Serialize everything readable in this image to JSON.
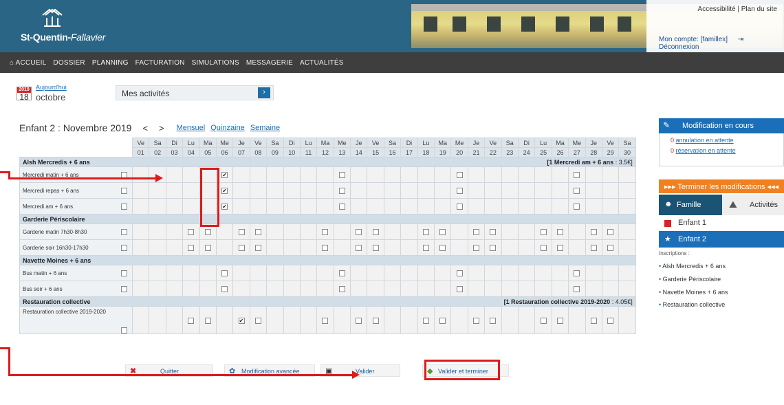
{
  "header": {
    "logo_line1": "St-Quentin-",
    "logo_line2": "Fallavier",
    "link_accessibility": "Accessibilité",
    "link_separator": "|",
    "link_sitemap": "Plan du site",
    "account": "Mon compte: [famillex]",
    "logout": "Déconnexion"
  },
  "nav": {
    "items": [
      "Accueil",
      "Dossier",
      "Planning",
      "Facturation",
      "Simulations",
      "Messagerie",
      "Actualités"
    ],
    "active": "Planning"
  },
  "date": {
    "today_link": "Aujourd'hui",
    "year": "2019",
    "day": "18",
    "month": "octobre"
  },
  "activities_select": {
    "value": "Mes activités"
  },
  "schedule": {
    "title": "Enfant 2 : Novembre 2019",
    "prev": "<",
    "next": ">",
    "views": [
      "Mensuel",
      "Quinzaine",
      "Semaine"
    ],
    "weekdays": [
      "Ve",
      "Sa",
      "Di",
      "Lu",
      "Ma",
      "Me",
      "Je",
      "Ve",
      "Sa",
      "Di",
      "Lu",
      "Ma",
      "Me",
      "Je",
      "Ve",
      "Sa",
      "Di",
      "Lu",
      "Ma",
      "Me",
      "Je",
      "Ve",
      "Sa",
      "Di",
      "Lu",
      "Ma",
      "Me",
      "Je",
      "Ve",
      "Sa"
    ],
    "dates": [
      "01",
      "02",
      "03",
      "04",
      "05",
      "06",
      "07",
      "08",
      "09",
      "10",
      "11",
      "12",
      "13",
      "14",
      "15",
      "16",
      "17",
      "18",
      "19",
      "20",
      "21",
      "22",
      "23",
      "24",
      "25",
      "26",
      "27",
      "28",
      "29",
      "30"
    ],
    "sections": [
      {
        "name": "Alsh Mercredis + 6 ans",
        "note_bold": "[1 Mercredi am + 6 ans",
        "note_rest": " : 3.5€]",
        "rows": [
          {
            "label": "Mercredi matin + 6 ans",
            "checkboxes": [
              6,
              13,
              20,
              27
            ],
            "checked": [
              6
            ],
            "tall": false
          },
          {
            "label": "Mercredi repas + 6 ans",
            "checkboxes": [
              6,
              13,
              20,
              27
            ],
            "checked": [
              6
            ],
            "tall": false
          },
          {
            "label": "Mercredi am + 6 ans",
            "checkboxes": [
              6,
              13,
              20,
              27
            ],
            "checked": [
              6
            ],
            "tall": false
          }
        ]
      },
      {
        "name": "Garderie Périscolaire",
        "note_bold": "",
        "note_rest": "",
        "rows": [
          {
            "label": "Garderie matin 7h30-8h30",
            "checkboxes": [
              4,
              5,
              7,
              8,
              12,
              14,
              15,
              18,
              19,
              21,
              22,
              25,
              26,
              28,
              29
            ],
            "checked": [],
            "tall": false
          },
          {
            "label": "Garderie soir 16h30-17h30",
            "checkboxes": [
              4,
              5,
              7,
              8,
              12,
              14,
              15,
              18,
              19,
              21,
              22,
              25,
              26,
              28,
              29
            ],
            "checked": [],
            "tall": false
          }
        ]
      },
      {
        "name": "Navette Moines + 6 ans",
        "note_bold": "",
        "note_rest": "",
        "rows": [
          {
            "label": "Bus matin + 6 ans",
            "checkboxes": [
              6,
              13,
              20,
              27
            ],
            "checked": [],
            "tall": false
          },
          {
            "label": "Bus soir + 6 ans",
            "checkboxes": [
              6,
              13,
              20,
              27
            ],
            "checked": [],
            "tall": false
          }
        ]
      },
      {
        "name": "Restauration collective",
        "note_bold": "[1 Restauration collective 2019-2020",
        "note_rest": " : 4.05€]",
        "rows": [
          {
            "label": "Restauration collective 2019-2020",
            "checkboxes": [
              4,
              5,
              7,
              8,
              12,
              14,
              15,
              18,
              19,
              21,
              22,
              25,
              26,
              28,
              29
            ],
            "checked": [
              7
            ],
            "tall": true
          }
        ]
      }
    ]
  },
  "buttons": {
    "quit": "Quitter",
    "advanced": "Modification avancée",
    "validate": "Valider",
    "validate_finish": "Valider et terminer"
  },
  "right_panel": {
    "mod_title": "Modification en cours",
    "cancel_count": "0",
    "cancel_text": "annulation en attente",
    "reserve_count": "0",
    "reserve_text": "réservation en attente",
    "finish": "▸▸▸ Terminer les modifications ◂◂◂",
    "tab_family": "Famille",
    "tab_activities": "Activités",
    "child1": "Enfant 1",
    "child2": "Enfant 2",
    "inscriptions_label": "Inscriptions :",
    "inscriptions": [
      "Alsh Mercredis + 6 ans",
      "Garderie Périscolaire",
      "Navette Moines + 6 ans",
      "Restauration collective"
    ]
  },
  "colors": {
    "header": "#2a6585",
    "nav": "#3e3e3e",
    "accent": "#1a6fb8",
    "annotation": "#e01a1a",
    "orange": "#f08020"
  }
}
